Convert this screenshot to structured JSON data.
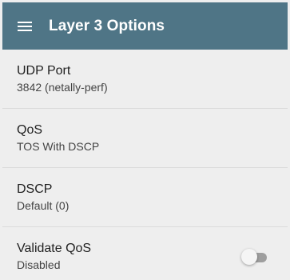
{
  "header": {
    "title": "Layer 3 Options",
    "menu_icon": "hamburger-menu-icon"
  },
  "settings": [
    {
      "title": "UDP Port",
      "value": "3842 (netally-perf)"
    },
    {
      "title": "QoS",
      "value": "TOS With DSCP"
    },
    {
      "title": "DSCP",
      "value": "Default (0)"
    },
    {
      "title": "Validate QoS",
      "value": "Disabled",
      "toggle_on": false
    }
  ],
  "colors": {
    "toolbar": "#4f7586",
    "background": "#eeeeee",
    "divider": "#dadada"
  }
}
